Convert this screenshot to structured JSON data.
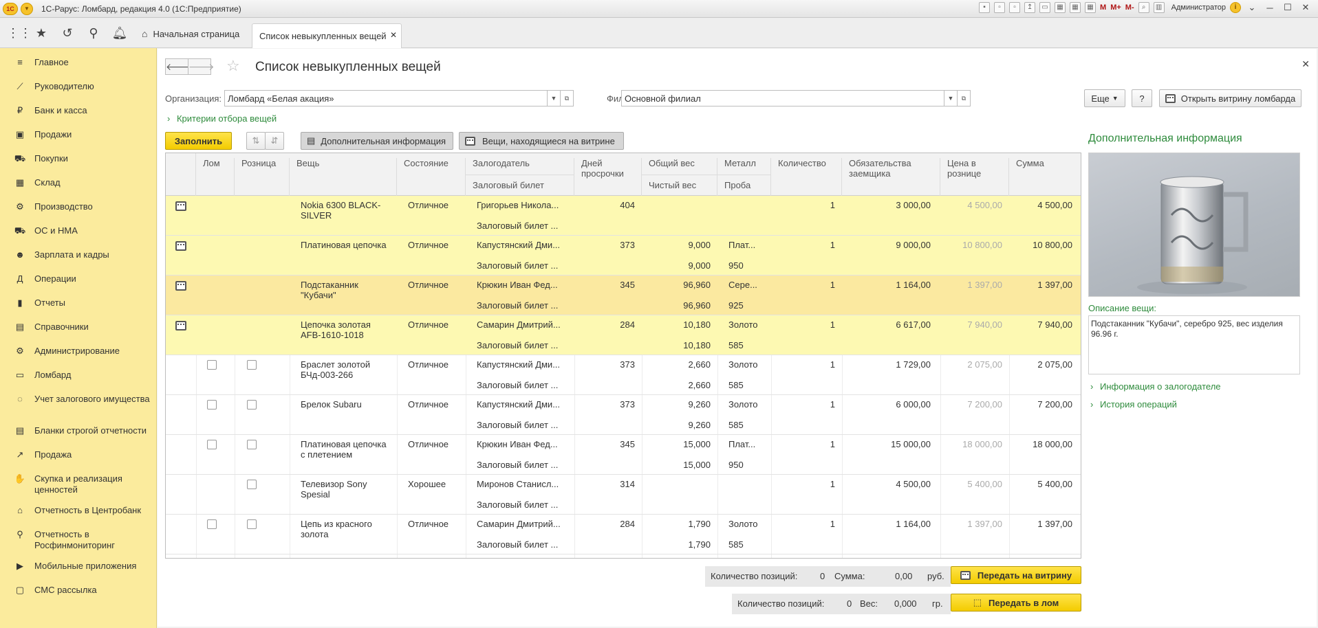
{
  "app": {
    "title": "1С-Рарус: Ломбард, редакция 4.0  (1С:Предприятие)",
    "user": "Администратор",
    "m_labels": [
      "M",
      "M+",
      "M-"
    ]
  },
  "tabs": {
    "home": "Начальная страница",
    "active": "Список невыкупленных вещей"
  },
  "sidebar": [
    {
      "label": "Главное",
      "icon": "menu-icon",
      "glyph": "≡"
    },
    {
      "label": "Руководителю",
      "icon": "chart-icon",
      "glyph": "⟋"
    },
    {
      "label": "Банк и касса",
      "icon": "coin-icon",
      "glyph": "₽"
    },
    {
      "label": "Продажи",
      "icon": "bag-icon",
      "glyph": "▣"
    },
    {
      "label": "Покупки",
      "icon": "cart-icon",
      "glyph": "⛟"
    },
    {
      "label": "Склад",
      "icon": "warehouse-icon",
      "glyph": "▦"
    },
    {
      "label": "Производство",
      "icon": "factory-icon",
      "glyph": "⚙"
    },
    {
      "label": "ОС и НМА",
      "icon": "truck-icon",
      "glyph": "⛟"
    },
    {
      "label": "Зарплата и кадры",
      "icon": "person-icon",
      "glyph": "☻"
    },
    {
      "label": "Операции",
      "icon": "debit-credit-icon",
      "glyph": "Д"
    },
    {
      "label": "Отчеты",
      "icon": "bar-chart-icon",
      "glyph": "▮"
    },
    {
      "label": "Справочники",
      "icon": "book-icon",
      "glyph": "▤"
    },
    {
      "label": "Администрирование",
      "icon": "gear-icon",
      "glyph": "⚙"
    },
    {
      "label": "Ломбард",
      "icon": "pawnshop-icon",
      "glyph": "▭"
    },
    {
      "label": "Учет залогового имущества",
      "icon": "ring-icon",
      "glyph": "◌"
    },
    {
      "label": "Бланки строгой отчетности",
      "icon": "forms-icon",
      "glyph": "▤"
    },
    {
      "label": "Продажа",
      "icon": "sale-icon",
      "glyph": "↗"
    },
    {
      "label": "Скупка и реализация ценностей",
      "icon": "hand-coin-icon",
      "glyph": "✋"
    },
    {
      "label": "Отчетность в Центробанк",
      "icon": "bank-icon",
      "glyph": "⌂"
    },
    {
      "label": "Отчетность в Росфинмониторинг",
      "icon": "magnifier-icon",
      "glyph": "⚲"
    },
    {
      "label": "Мобильные приложения",
      "icon": "play-icon",
      "glyph": "▶"
    },
    {
      "label": "СМС рассылка",
      "icon": "sms-icon",
      "glyph": "▢"
    }
  ],
  "form": {
    "title": "Список невыкупленных вещей",
    "org_label": "Организация:",
    "org_value": "Ломбард «Белая акация»",
    "branch_label": "Филиал:",
    "branch_value": "Основной филиал",
    "more_label": "Еще",
    "help_label": "?",
    "open_showcase_label": "Открыть витрину ломбарда",
    "criteria_label": "Критерии отбора вещей",
    "fill_label": "Заполнить",
    "extra_info_label": "Дополнительная информация",
    "items_showcase_label": "Вещи, находящиеся на витрине"
  },
  "grid": {
    "headers": {
      "lom": "Лом",
      "retail": "Розница",
      "item": "Вещь",
      "state": "Состояние",
      "pledger": "Залогодатель",
      "ticket": "Залоговый билет",
      "days": "Дней просрочки",
      "total_weight": "Общий вес",
      "net_weight": "Чистый вес",
      "metal": "Металл",
      "probe": "Проба",
      "qty": "Количество",
      "obligations": "Обязательства заемщика",
      "retail_price": "Цена в рознице",
      "sum": "Сумма"
    },
    "rows": [
      {
        "showcase": true,
        "hl": "hl",
        "cb": false,
        "item": "Nokia 6300 BLACK-SILVER",
        "state": "Отличное",
        "pledger": "Григорьев Никола...",
        "ticket": "Залоговый билет ...",
        "days": "404",
        "tw": "",
        "nw": "",
        "metal": "",
        "probe": "",
        "qty": "1",
        "obl": "3 000,00",
        "price": "4 500,00",
        "sum": "4 500,00"
      },
      {
        "showcase": true,
        "hl": "hl",
        "cb": false,
        "item": "Платиновая цепочка",
        "state": "Отличное",
        "pledger": "Капустянский Дми...",
        "ticket": "Залоговый билет ...",
        "days": "373",
        "tw": "9,000",
        "nw": "9,000",
        "metal": "Плат...",
        "probe": "950",
        "qty": "1",
        "obl": "9 000,00",
        "price": "10 800,00",
        "sum": "10 800,00"
      },
      {
        "showcase": true,
        "hl": "sel",
        "cb": false,
        "item": "Подстаканник \"Кубачи\"",
        "state": "Отличное",
        "pledger": "Крюкин Иван Фед...",
        "ticket": "Залоговый билет ...",
        "days": "345",
        "tw": "96,960",
        "nw": "96,960",
        "metal": "Сере...",
        "probe": "925",
        "qty": "1",
        "obl": "1 164,00",
        "price": "1 397,00",
        "sum": "1 397,00"
      },
      {
        "showcase": true,
        "hl": "hl",
        "cb": false,
        "item": "Цепочка золотая AFB-1610-1018",
        "state": "Отличное",
        "pledger": "Самарин Дмитрий...",
        "ticket": "Залоговый билет ...",
        "days": "284",
        "tw": "10,180",
        "nw": "10,180",
        "metal": "Золото",
        "probe": "585",
        "qty": "1",
        "obl": "6 617,00",
        "price": "7 940,00",
        "sum": "7 940,00"
      },
      {
        "showcase": false,
        "hl": "",
        "cb": true,
        "lomcb": true,
        "item": "Браслет золотой БЧд-003-266",
        "state": "Отличное",
        "pledger": "Капустянский Дми...",
        "ticket": "Залоговый билет ...",
        "days": "373",
        "tw": "2,660",
        "nw": "2,660",
        "metal": "Золото",
        "probe": "585",
        "qty": "1",
        "obl": "1 729,00",
        "price": "2 075,00",
        "sum": "2 075,00"
      },
      {
        "showcase": false,
        "hl": "",
        "cb": true,
        "lomcb": true,
        "item": "Брелок Subaru",
        "state": "Отличное",
        "pledger": "Капустянский Дми...",
        "ticket": "Залоговый билет ...",
        "days": "373",
        "tw": "9,260",
        "nw": "9,260",
        "metal": "Золото",
        "probe": "585",
        "qty": "1",
        "obl": "6 000,00",
        "price": "7 200,00",
        "sum": "7 200,00"
      },
      {
        "showcase": false,
        "hl": "",
        "cb": true,
        "lomcb": true,
        "item": "Платиновая цепочка с плетением",
        "state": "Отличное",
        "pledger": "Крюкин Иван Фед...",
        "ticket": "Залоговый билет ...",
        "days": "345",
        "tw": "15,000",
        "nw": "15,000",
        "metal": "Плат...",
        "probe": "950",
        "qty": "1",
        "obl": "15 000,00",
        "price": "18 000,00",
        "sum": "18 000,00"
      },
      {
        "showcase": false,
        "hl": "",
        "cb": true,
        "lomcb": false,
        "item": "Телевизор Sony Spesial",
        "state": "Хорошее",
        "pledger": "Миронов Станисл...",
        "ticket": "Залоговый билет ...",
        "days": "314",
        "tw": "",
        "nw": "",
        "metal": "",
        "probe": "",
        "qty": "1",
        "obl": "4 500,00",
        "price": "5 400,00",
        "sum": "5 400,00"
      },
      {
        "showcase": false,
        "hl": "",
        "cb": true,
        "lomcb": true,
        "item": "Цепь из красного золота",
        "state": "Отличное",
        "pledger": "Самарин Дмитрий...",
        "ticket": "Залоговый билет ...",
        "days": "284",
        "tw": "1,790",
        "nw": "1,790",
        "metal": "Золото",
        "probe": "585",
        "qty": "1",
        "obl": "1 164,00",
        "price": "1 397,00",
        "sum": "1 397,00"
      }
    ]
  },
  "right_panel": {
    "title": "Дополнительная информация",
    "desc_label": "Описание вещи:",
    "desc_text": "Подстаканник \"Кубачи\", серебро 925, вес изделия 96.96 г.",
    "link_pledger": "Информация о залогодателе",
    "link_history": "История операций"
  },
  "footer": {
    "count_label": "Количество позиций:",
    "count1": "0",
    "sum_label": "Сумма:",
    "sum_value": "0,00",
    "rub": "руб.",
    "to_showcase": "Передать на витрину",
    "count2": "0",
    "weight_label": "Вес:",
    "weight_value": "0,000",
    "gr": "гр.",
    "to_scrap": "Передать в лом"
  },
  "colors": {
    "sidebar_bg": "#fbeb9d",
    "accent_green": "#2e8b3c",
    "yellow_button": "#f3cc00",
    "row_highlight": "#fdf9b2"
  }
}
